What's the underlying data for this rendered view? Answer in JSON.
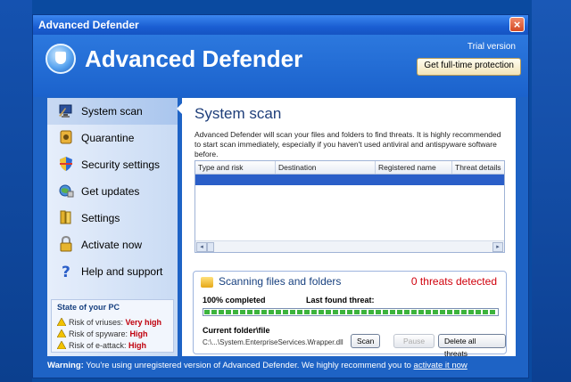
{
  "window": {
    "title": "Advanced Defender",
    "close_glyph": "×"
  },
  "header": {
    "app_name": "Advanced Defender",
    "trial_label": "Trial version",
    "cta_label": "Get full-time protection",
    "logo_icon": "shield-logo-icon"
  },
  "sidebar": {
    "items": [
      {
        "label": "System scan",
        "icon": "computer-scan-icon",
        "active": true
      },
      {
        "label": "Quarantine",
        "icon": "quarantine-icon",
        "active": false
      },
      {
        "label": "Security settings",
        "icon": "shield-icon",
        "active": false
      },
      {
        "label": "Get updates",
        "icon": "globe-update-icon",
        "active": false
      },
      {
        "label": "Settings",
        "icon": "settings-books-icon",
        "active": false
      },
      {
        "label": "Activate now",
        "icon": "lock-icon",
        "active": false
      },
      {
        "label": "Help and support",
        "icon": "question-icon",
        "active": false
      }
    ],
    "state": {
      "title": "State of your PC",
      "risks": [
        {
          "label": "Risk of vriuses:",
          "value": "Very high"
        },
        {
          "label": "Risk of spyware:",
          "value": "High"
        },
        {
          "label": "Risk of e-attack:",
          "value": "High"
        }
      ]
    }
  },
  "main": {
    "title": "System scan",
    "description": "Advanced Defender will scan your files and folders to find threats. It is highly recommended to start scan immediately, especially if you haven't used antiviral and antispyware software before.",
    "table": {
      "columns": [
        "Type and risk",
        "Destination",
        "Registered name",
        "Threat details"
      ],
      "scroll_left": "◂",
      "scroll_right": "▸"
    },
    "scan": {
      "title": "Scanning files and folders",
      "threats": "0 threats detected",
      "completed_label": "100% completed",
      "progress": 1.0,
      "last_threat_label": "Last found threat:",
      "folder_label": "Current folder\\file",
      "folder_path": "C:\\...\\System.EnterpriseServices.Wrapper.dll",
      "buttons": {
        "scan": "Scan",
        "pause": "Pause",
        "delete": "Delete all threats"
      }
    }
  },
  "warning": {
    "prefix": "Warning:",
    "text": "You're using unregistered version of Advanced Defender. We highly recommend you to",
    "link": "activate it now"
  },
  "colors": {
    "accent": "#1e63c5",
    "threat_red": "#d0000c",
    "progress_green": "#3cb43c"
  }
}
